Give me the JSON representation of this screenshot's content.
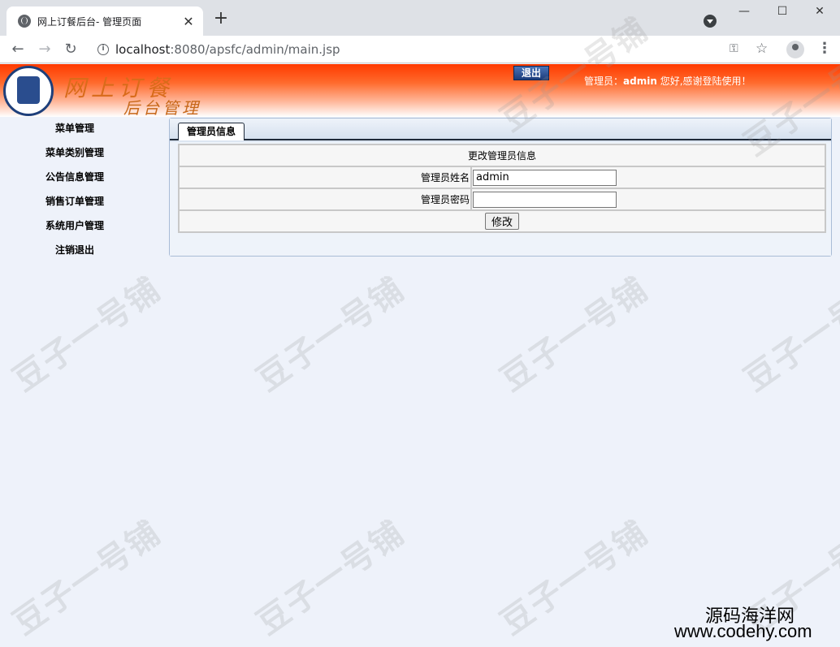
{
  "browser": {
    "tab_title": "网上订餐后台- 管理页面",
    "url_host": "localhost",
    "url_port_path": ":8080/apsfc/admin/main.jsp"
  },
  "banner": {
    "brand_line1": "网上订餐",
    "brand_line2": "后台管理",
    "logout_label": "退出",
    "welcome_prefix": "管理员：",
    "welcome_user": "admin",
    "welcome_suffix": " 您好,感谢登陆使用！"
  },
  "sidebar": {
    "items": [
      {
        "label": "菜单管理"
      },
      {
        "label": "菜单类别管理"
      },
      {
        "label": "公告信息管理"
      },
      {
        "label": "销售订单管理"
      },
      {
        "label": "系统用户管理"
      },
      {
        "label": "注销退出"
      }
    ]
  },
  "panel": {
    "tab_label": "管理员信息",
    "form_title": "更改管理员信息",
    "name_label": "管理员姓名",
    "name_value": "admin",
    "password_label": "管理员密码",
    "password_value": "",
    "submit_label": "修改"
  },
  "watermark": "豆子一号铺",
  "credit": {
    "line1": "源码海洋网",
    "line2": "www.codehy.com"
  }
}
